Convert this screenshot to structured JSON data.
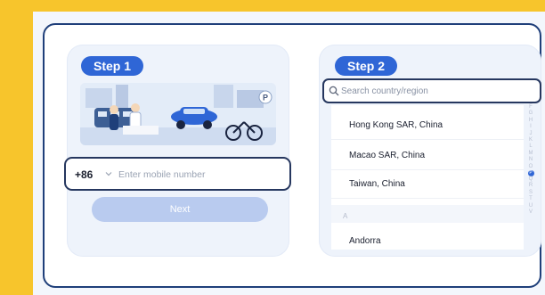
{
  "colors": {
    "background": "#f7c52c",
    "accent": "#2f66d6",
    "border_dark": "#26375f",
    "button_disabled": "#b9cbef"
  },
  "step1": {
    "label": "Step 1",
    "country_code": "+86",
    "phone_placeholder": "Enter mobile number",
    "next_label": "Next"
  },
  "step2": {
    "label": "Step 2",
    "search_placeholder": "Search country/region",
    "regions": [
      "Hong Kong SAR, China",
      "Macao SAR, China",
      "Taiwan, China"
    ],
    "section_letter": "A",
    "countries_a": [
      "Andorra"
    ],
    "index_letters": [
      "F",
      "G",
      "H",
      "I",
      "J",
      "K",
      "L",
      "M",
      "N",
      "O",
      "P",
      "Q",
      "R",
      "S",
      "T",
      "U",
      "V"
    ],
    "index_active": "P"
  },
  "icons": {
    "search": "search-icon",
    "dropdown": "chevron-down-icon",
    "parking": "parking-icon"
  }
}
